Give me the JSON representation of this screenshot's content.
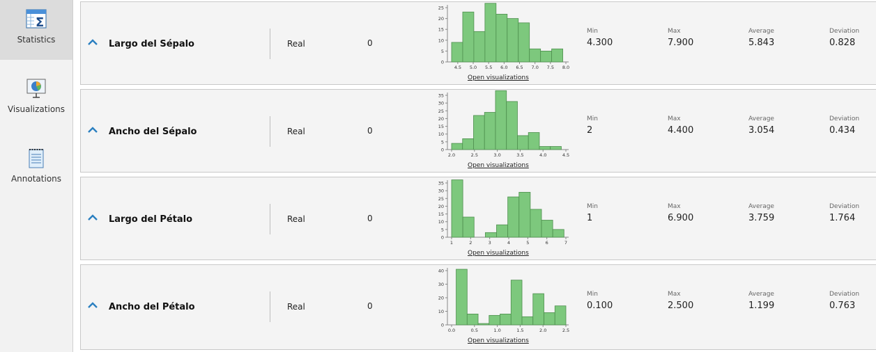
{
  "sidebar": {
    "items": [
      {
        "label": "Statistics",
        "icon": "statistics-icon",
        "active": true
      },
      {
        "label": "Visualizations",
        "icon": "visualizations-icon",
        "active": false
      },
      {
        "label": "Annotations",
        "icon": "annotations-icon",
        "active": false
      }
    ]
  },
  "stat_labels": {
    "min": "Min",
    "max": "Max",
    "average": "Average",
    "deviation": "Deviation"
  },
  "open_label": "Open visualizations",
  "colors": {
    "bar_fill": "#7dc87d",
    "bar_stroke": "#4e8f4e",
    "accent_chevron": "#2a7fc0"
  },
  "attributes": [
    {
      "name": "Largo del Sépalo",
      "type": "Real",
      "missing": "0",
      "min": "4.300",
      "max": "7.900",
      "average": "5.843",
      "deviation": "0.828",
      "chart_data": {
        "type": "bar",
        "xmin": 4.3,
        "xmax": 8.0,
        "bins": [
          [
            4.3,
            4.66,
            9
          ],
          [
            4.66,
            5.02,
            23
          ],
          [
            5.02,
            5.38,
            14
          ],
          [
            5.38,
            5.74,
            27
          ],
          [
            5.74,
            6.1,
            22
          ],
          [
            6.1,
            6.46,
            20
          ],
          [
            6.46,
            6.82,
            18
          ],
          [
            6.82,
            7.18,
            6
          ],
          [
            7.18,
            7.54,
            5
          ],
          [
            7.54,
            7.9,
            6
          ]
        ],
        "xticks": [
          "4.5",
          "5.0",
          "5.5",
          "6.0",
          "6.5",
          "7.0",
          "7.5",
          "8.0"
        ],
        "yticks": [
          "0",
          "5",
          "10",
          "15",
          "20",
          "25"
        ],
        "ylim": [
          0,
          25
        ]
      }
    },
    {
      "name": "Ancho del Sépalo",
      "type": "Real",
      "missing": "0",
      "min": "2",
      "max": "4.400",
      "average": "3.054",
      "deviation": "0.434",
      "chart_data": {
        "type": "bar",
        "xmin": 2.0,
        "xmax": 4.5,
        "bins": [
          [
            2.0,
            2.24,
            4
          ],
          [
            2.24,
            2.48,
            7
          ],
          [
            2.48,
            2.72,
            22
          ],
          [
            2.72,
            2.96,
            24
          ],
          [
            2.96,
            3.2,
            38
          ],
          [
            3.2,
            3.44,
            31
          ],
          [
            3.44,
            3.68,
            9
          ],
          [
            3.68,
            3.92,
            11
          ],
          [
            3.92,
            4.16,
            2
          ],
          [
            4.16,
            4.4,
            2
          ]
        ],
        "xticks": [
          "2.0",
          "2.5",
          "3.0",
          "3.5",
          "4.0",
          "4.5"
        ],
        "yticks": [
          "0",
          "5",
          "10",
          "15",
          "20",
          "25",
          "30",
          "35"
        ],
        "ylim": [
          0,
          35
        ]
      }
    },
    {
      "name": "Largo del Pétalo",
      "type": "Real",
      "missing": "0",
      "min": "1",
      "max": "6.900",
      "average": "3.759",
      "deviation": "1.764",
      "chart_data": {
        "type": "bar",
        "xmin": 1.0,
        "xmax": 7.0,
        "bins": [
          [
            1.0,
            1.59,
            37
          ],
          [
            1.59,
            2.18,
            13
          ],
          [
            2.18,
            2.77,
            0
          ],
          [
            2.77,
            3.36,
            3
          ],
          [
            3.36,
            3.95,
            8
          ],
          [
            3.95,
            4.54,
            26
          ],
          [
            4.54,
            5.13,
            29
          ],
          [
            5.13,
            5.72,
            18
          ],
          [
            5.72,
            6.31,
            11
          ],
          [
            6.31,
            6.9,
            5
          ]
        ],
        "xticks": [
          "1",
          "2",
          "3",
          "4",
          "5",
          "6",
          "7"
        ],
        "yticks": [
          "0",
          "5",
          "10",
          "15",
          "20",
          "25",
          "30",
          "35"
        ],
        "ylim": [
          0,
          35
        ]
      }
    },
    {
      "name": "Ancho del Pétalo",
      "type": "Real",
      "missing": "0",
      "min": "0.100",
      "max": "2.500",
      "average": "1.199",
      "deviation": "0.763",
      "chart_data": {
        "type": "bar",
        "xmin": 0.0,
        "xmax": 2.5,
        "bins": [
          [
            0.1,
            0.34,
            41
          ],
          [
            0.34,
            0.58,
            8
          ],
          [
            0.58,
            0.82,
            1
          ],
          [
            0.82,
            1.06,
            7
          ],
          [
            1.06,
            1.3,
            8
          ],
          [
            1.3,
            1.54,
            33
          ],
          [
            1.54,
            1.78,
            6
          ],
          [
            1.78,
            2.02,
            23
          ],
          [
            2.02,
            2.26,
            9
          ],
          [
            2.26,
            2.5,
            14
          ]
        ],
        "xticks": [
          "0.0",
          "0.5",
          "1.0",
          "1.5",
          "2.0",
          "2.5"
        ],
        "yticks": [
          "0",
          "10",
          "20",
          "30",
          "40"
        ],
        "ylim": [
          0,
          40
        ]
      }
    }
  ]
}
